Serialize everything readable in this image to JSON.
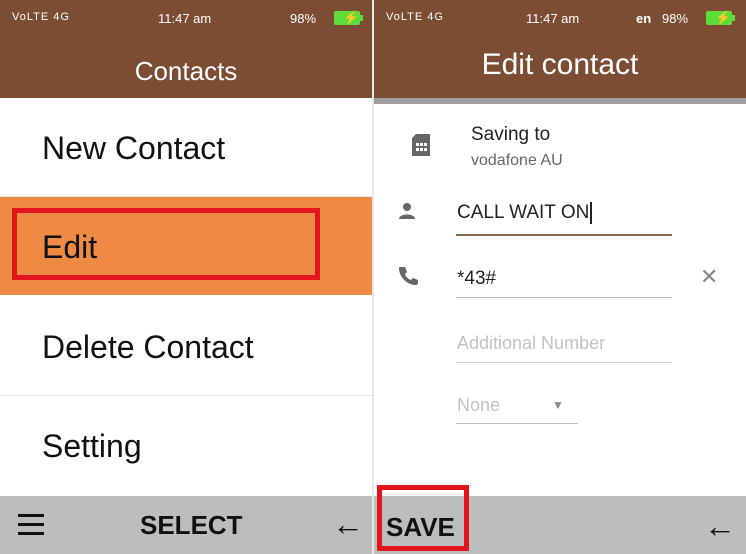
{
  "left_screen": {
    "status": {
      "network": "VoLTE 4G",
      "time": "11:47 am",
      "battery": "98%"
    },
    "title": "Contacts",
    "menu": [
      {
        "label": "New Contact"
      },
      {
        "label": "Edit"
      },
      {
        "label": "Delete Contact"
      },
      {
        "label": "Setting"
      }
    ],
    "softkeys": {
      "center": "SELECT",
      "right": "←"
    }
  },
  "right_screen": {
    "status": {
      "network": "VoLTE 4G",
      "time": "11:47 am",
      "lang": "en",
      "battery": "98%"
    },
    "title": "Edit contact",
    "saving_to_label": "Saving to",
    "saving_to_account": "vodafone AU",
    "name_value": "CALL WAIT ON",
    "phone_value": "*43#",
    "additional_placeholder": "Additional Number",
    "type_select": "None",
    "softkeys": {
      "left": "SAVE",
      "right": "←"
    }
  },
  "colors": {
    "header": "#7c4d33",
    "selected": "#ef8a45",
    "highlight": "#e3141c",
    "softkey_bar": "#bdbdbd"
  },
  "icons": [
    "sim-card-icon",
    "person-icon",
    "phone-icon",
    "clear-icon",
    "dropdown-arrow-icon",
    "hamburger-menu-icon",
    "back-arrow-icon",
    "battery-icon"
  ]
}
